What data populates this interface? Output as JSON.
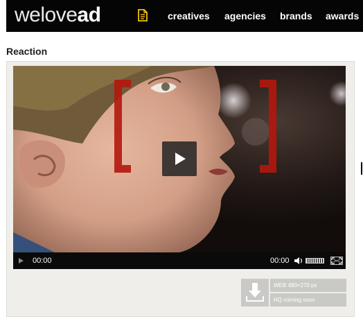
{
  "header": {
    "logo_light": "welove",
    "logo_bold": "ad",
    "nav": [
      "creatives",
      "agencies",
      "brands",
      "awards"
    ]
  },
  "page_title": "Reaction",
  "player": {
    "current_time": "00:00",
    "total_time": "00:00"
  },
  "download": {
    "web_label": "WEB 480×270 px",
    "hq_label": "HQ coming soon"
  },
  "colors": {
    "header_bg": "#050505",
    "accent": "#f5c400",
    "panel_bg": "#efeeea",
    "bracket_red": "#b4170d"
  },
  "icons": [
    "document-icon",
    "play-icon",
    "volume-icon",
    "fullscreen-icon",
    "download-icon"
  ]
}
